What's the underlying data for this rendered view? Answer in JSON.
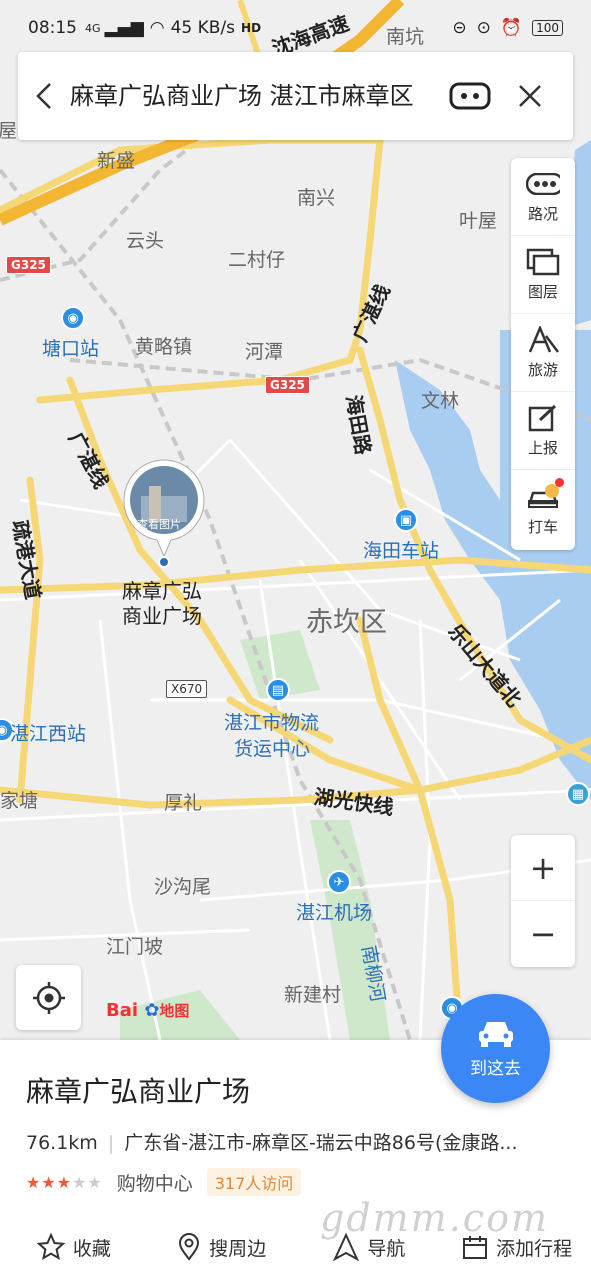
{
  "status_bar": {
    "time": "08:15",
    "network": "4G",
    "speed": "45 KB/s",
    "hd": "HD",
    "battery": "100"
  },
  "search": {
    "query": "麻章广弘商业广场 湛江市麻章区"
  },
  "toolbar": {
    "items": [
      {
        "label": "路况",
        "icon": "traffic-icon"
      },
      {
        "label": "图层",
        "icon": "layers-icon"
      },
      {
        "label": "旅游",
        "icon": "travel-icon"
      },
      {
        "label": "上报",
        "icon": "report-icon"
      },
      {
        "label": "打车",
        "icon": "taxi-icon"
      }
    ]
  },
  "map": {
    "marker": {
      "photo_label": "查看图片",
      "name_line1": "麻章广弘",
      "name_line2": "商业广场"
    },
    "places": [
      "新盛",
      "南兴",
      "叶屋",
      "云头",
      "二村仔",
      "黄略镇",
      "河潭",
      "文林",
      "赤坎区",
      "厚礼",
      "沙沟尾",
      "江门坡",
      "新建村",
      "南坑",
      "家塘",
      "屋柱"
    ],
    "stations": [
      "塘口站",
      "海田车站",
      "湛江西站",
      "湛江市物流",
      "货运中心",
      "湛江机场"
    ],
    "roads": [
      "沈海高速",
      "广湛线",
      "海田路",
      "广湛线",
      "疏港大道",
      "湖光快线",
      "乐山大道北",
      "南柳河"
    ],
    "shields": [
      "G325",
      "G325",
      "X670"
    ],
    "logo_bai": "Bai",
    "logo_du": "地图"
  },
  "zoom": {
    "in": "+",
    "out": "−"
  },
  "go_button": {
    "label": "到这去"
  },
  "place": {
    "name": "麻章广弘商业广场",
    "distance": "76.1km",
    "address": "广东省-湛江市-麻章区-瑞云中路86号(金康路...",
    "rating": 3,
    "category": "购物中心",
    "visits": "317人访问"
  },
  "actions": [
    {
      "label": "收藏",
      "icon": "star-outline-icon"
    },
    {
      "label": "搜周边",
      "icon": "location-pin-icon"
    },
    {
      "label": "导航",
      "icon": "navigation-arrow-icon"
    },
    {
      "label": "添加行程",
      "icon": "calendar-icon"
    }
  ],
  "watermark": "gdmm.com"
}
